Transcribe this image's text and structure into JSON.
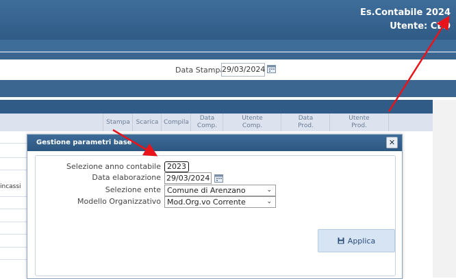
{
  "header": {
    "accounting_year": "Es.Contabile 2024",
    "user": "Utente: CED"
  },
  "filter": {
    "label": "Data Stampa",
    "value": "29/03/2024"
  },
  "grid": {
    "columns": [
      {
        "label": "Stampa"
      },
      {
        "label": "Scarica"
      },
      {
        "label": "Compila"
      },
      {
        "label": "Data\nComp."
      },
      {
        "label": "Utente\nComp."
      },
      {
        "label": "Data\nProd."
      },
      {
        "label": "Utente\nProd."
      }
    ],
    "row_fragment": "incassi"
  },
  "modal": {
    "title": "Gestione parametri base",
    "close": "✕",
    "fields": {
      "anno_label": "Selezione anno contabile",
      "anno_value": "2023",
      "data_label": "Data elaborazione",
      "data_value": "29/03/2024",
      "ente_label": "Selezione ente",
      "ente_value": "Comune di Arenzano",
      "modello_label": "Modello Organizzativo",
      "modello_value": "Mod.Org.vo Corrente"
    },
    "apply_label": "Applica"
  },
  "colors": {
    "brand_blue": "#2f5b86",
    "annotation_arrow": "#e8141a"
  },
  "icons": {
    "calendar": "calendar-icon",
    "save": "floppy-icon",
    "close": "close-icon",
    "chevron": "chevron-down-icon"
  }
}
